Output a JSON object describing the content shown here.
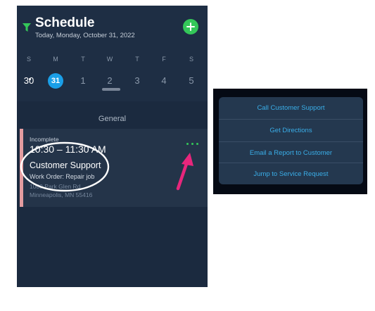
{
  "header": {
    "title": "Schedule",
    "date_line": "Today, Monday, October 31, 2022"
  },
  "week": {
    "days": [
      "S",
      "M",
      "T",
      "W",
      "T",
      "F",
      "S"
    ],
    "dates": [
      "30",
      "31",
      "1",
      "2",
      "3",
      "4",
      "5"
    ],
    "selected_date": "31"
  },
  "section": {
    "label": "General"
  },
  "appointment": {
    "status": "Incomplete",
    "time": "10:30 – 11:30 AM",
    "title": "Customer Support",
    "work_order": "Work Order: Repair job",
    "address_line1": "1000 Park Glen Rd",
    "address_line2": "Minneapolis, MN 55416"
  },
  "menu": {
    "items": [
      "Call Customer Support",
      "Get Directions",
      "Email a Report to Customer",
      "Jump to Service Request"
    ]
  },
  "colors": {
    "accent_green": "#34c759",
    "accent_blue": "#1a9fe8",
    "incomplete_bar": "#e39ca0",
    "annotation_arrow": "#e8267c",
    "annotation_highlight": "#b8e04a",
    "annotation_circle": "#ffffff"
  }
}
